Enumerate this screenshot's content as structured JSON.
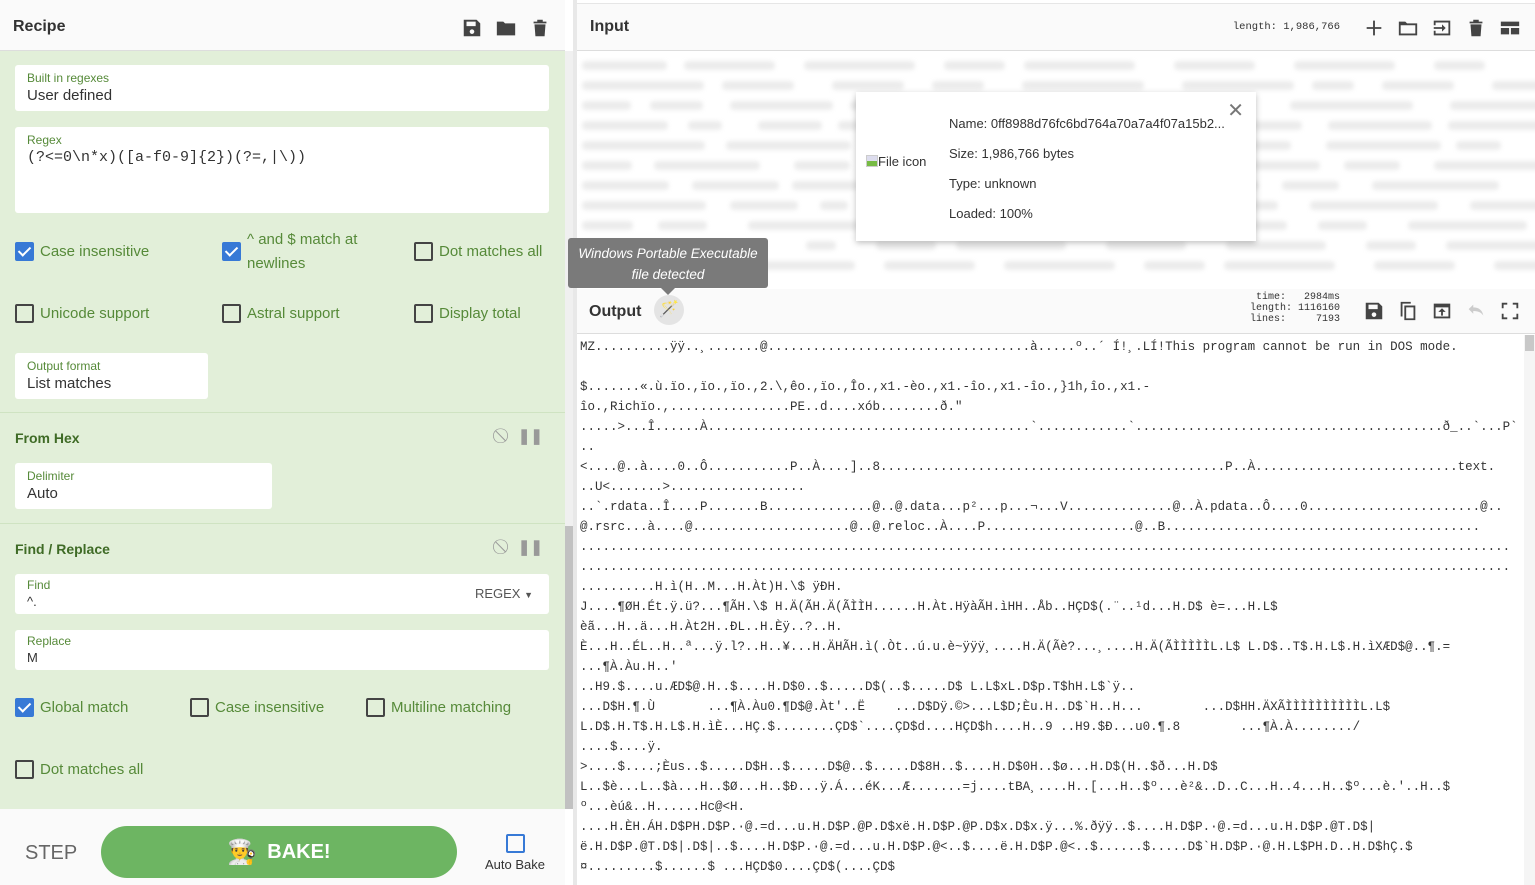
{
  "recipe": {
    "title": "Recipe",
    "regex_op": {
      "builtin_label": "Built in regexes",
      "builtin_value": "User defined",
      "regex_label": "Regex",
      "regex_value": "(?<=0\\n*x)([a-f0-9]{2})(?=,|\\))",
      "options": [
        {
          "label": "Case insensitive",
          "checked": true
        },
        {
          "label": "^ and $ match at newlines",
          "checked": true
        },
        {
          "label": "Dot matches all",
          "checked": false
        },
        {
          "label": "Unicode support",
          "checked": false
        },
        {
          "label": "Astral support",
          "checked": false
        },
        {
          "label": "Display total",
          "checked": false
        }
      ],
      "output_format_label": "Output format",
      "output_format_value": "List matches"
    },
    "from_hex": {
      "title": "From Hex",
      "delimiter_label": "Delimiter",
      "delimiter_value": "Auto"
    },
    "find_replace": {
      "title": "Find / Replace",
      "find_label": "Find",
      "find_value": "^.",
      "find_mode": "REGEX",
      "replace_label": "Replace",
      "replace_value": "M",
      "options": [
        {
          "label": "Global match",
          "checked": true
        },
        {
          "label": "Case insensitive",
          "checked": false
        },
        {
          "label": "Multiline matching",
          "checked": false
        },
        {
          "label": "Dot matches all",
          "checked": false
        }
      ]
    },
    "step_label": "STEP",
    "bake_label": "BAKE!",
    "auto_bake_label": "Auto Bake",
    "auto_bake_checked": false
  },
  "input": {
    "title": "Input",
    "length": "length: 1,986,766",
    "file": {
      "icon_alt": "File icon",
      "name": "Name: 0ff8988d76fc6bd764a70a7a4f07a15b2...",
      "size": "Size: 1,986,766 bytes",
      "type": "Type: unknown",
      "loaded": "Loaded: 100%",
      "loaded_percent": 100
    }
  },
  "tooltip": "Windows Portable Executable file detected",
  "output": {
    "title": "Output",
    "stats": "time:   2984ms\nlength: 1116160\nlines:     7193",
    "lines": [
      "MZ..........ÿÿ..¸.......@...................................à.....º..´ Í!¸.LÍ!This program cannot be run in DOS mode.",
      "",
      "$.......«.ù.ïo.,ïo.,ïo.,2.\\,êo.,ïo.,Îo.,x1.-èo.,x1.-îo.,x1.-îo.,}1h,îo.,x1.-",
      "îo.,Richïo.,................PE..d....xób........ð.\"",
      ".....>...Î......À...........................................`............`.........................................ð_..`...P`",
      "..",
      "<....@..à....0..Ô...........P..À....]..8..............................................P..À...........................text.",
      "..U<.......>..................",
      "..`.rdata..Î....P.......B..............@..@.data...p²...p...¬...V..............@..À.pdata..Ô....0.......................@..",
      "@.rsrc...à....@.....................@..@.reloc..À....P....................@..B..........................................",
      "............................................................................................................................",
      "............................................................................................................................",
      "..........H.ì(H..M...H.Àt)H.\\$ ÿÐH.",
      "J....¶ØH.Ét.ÿ.ü?...¶ÃH.\\$ H.Ä(ÃH.Ä(ÃÌÌH......H.Àt.HÿàÃH.ìHH..Åb..HÇD$(.¨..¹d...H.D$ è=...H.L$",
      "èã...H..ä...H.Àt2H..ÐL..H.Èÿ..?..H.",
      "È...H..ÉL..H..ª...ÿ.l?..H..¥...H.ÄHÃH.ì(.Òt..ú.u.è~ÿÿÿ¸....H.Ä(Ãè?...¸....H.Ä(ÃÌÌÌÌÌL.L$ L.D$..T$.H.L$.H.ìXÆD$@..¶.=",
      "...¶À.Àu.H..'",
      "..H9.$....u.ÆD$@.H..$....H.D$0..$.....D$(..$.....D$ L.L$xL.D$p.T$hH.L$`ÿ..",
      "...D$H.¶.Ù       ...¶À.Àu0.¶D$@.Àt'..Ë    ...D$Dÿ.©>...L$D;Èu.H..D$`H..H...        ...D$HH.ÄXÃÌÌÌÌÌÌÌÌÌÌL.L$",
      "L.D$.H.T$.H.L$.H.ìÈ...HÇ.$........ÇD$`....ÇD$d....HÇD$h....H..9 ..H9.$Ð...u0.¶.8        ...¶À.À......../",
      "....$....ÿ.",
      ">....$....;Èus..$.....D$H..$.....D$@..$.....D$8H..$....H.D$0H..$ø...H.D$(H..$ð...H.D$",
      "L..$è...L..$à...H..$Ø...H..$Ð...ÿ.Á...éK...Æ.......=j....tBA¸....H..[...H..$º...è²&..D..C...H..4...H..$º...è.'..H..$",
      "º...èú&..H......Hc@<H.",
      "....H.ÈH.ÁH.D$PH.D$P.·@.=d...u.H.D$P.@P.D$xë.H.D$P.@P.D$x.D$x.ÿ...%.ðÿÿ..$....H.D$P.·@.=d...u.H.D$P.@T.D$|",
      "ë.H.D$P.@T.D$|.D$|..$....H.D$P.·@.=d...u.H.D$P.@<..$....ë.H.D$P.@<..$......$.....D$`H.D$P.·@.H.L$PH.D..H.D$hÇ.$",
      "¤.........$......$ ...HÇD$0....ÇD$(....ÇD$"
    ]
  },
  "colors": {
    "recipe_bg": "#e2efd9",
    "label_green": "#568a39",
    "checkbox_blue": "#3779d6",
    "bake_green": "#6db562"
  }
}
